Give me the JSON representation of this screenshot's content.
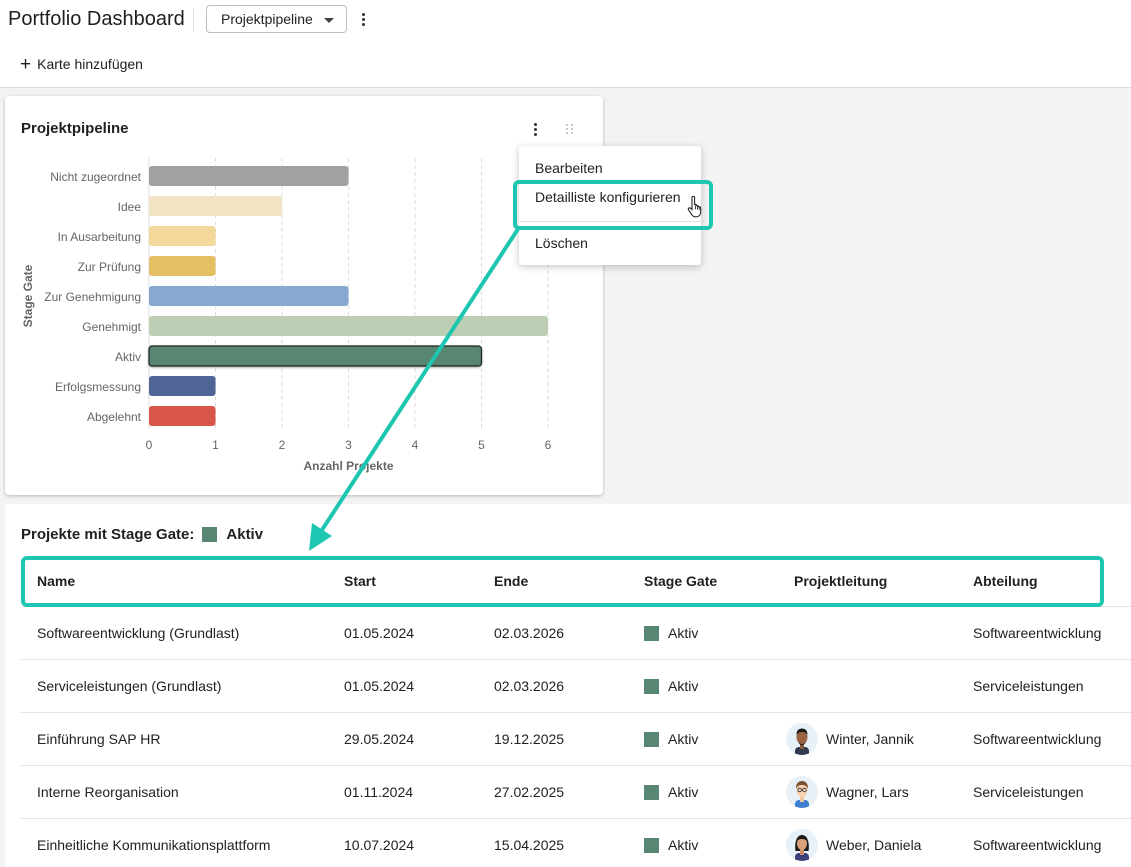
{
  "header": {
    "title": "Portfolio Dashboard",
    "view_select": "Projektpipeline",
    "add_card_label": "Karte hinzufügen"
  },
  "chart_card": {
    "title": "Projektpipeline"
  },
  "chart_data": {
    "type": "bar",
    "orientation": "horizontal",
    "categories": [
      "Nicht zugeordnet",
      "Idee",
      "In Ausarbeitung",
      "Zur Prüfung",
      "Zur Genehmigung",
      "Genehmigt",
      "Aktiv",
      "Erfolgsmessung",
      "Abgelehnt"
    ],
    "values": [
      3,
      2,
      1,
      1,
      3,
      6,
      5,
      1,
      1
    ],
    "colors": [
      "#a1a1a1",
      "#f0e4c5",
      "#f4d79b",
      "#e4c064",
      "#87a8d0",
      "#bccfb4",
      "#578672",
      "#4f6595",
      "#d9564a"
    ],
    "highlighted_category": "Aktiv",
    "xlabel": "Anzahl Projekte",
    "ylabel": "Stage Gate",
    "xlim": [
      0,
      6
    ],
    "xticks": [
      0,
      1,
      2,
      3,
      4,
      5,
      6
    ],
    "grid": "vertical dashed"
  },
  "context_menu": {
    "items": [
      "Bearbeiten",
      "Detailliste konfigurieren",
      "Löschen"
    ]
  },
  "detail_list": {
    "title": "Projekte mit Stage Gate:",
    "stage": "Aktiv",
    "stage_color": "#578672",
    "columns": [
      "Name",
      "Start",
      "Ende",
      "Stage Gate",
      "Projektleitung",
      "Abteilung"
    ],
    "rows": [
      {
        "name": "Softwareentwicklung (Grundlast)",
        "start": "01.05.2024",
        "end": "02.03.2026",
        "stage": "Aktiv",
        "lead": "",
        "dept": "Softwareentwicklung"
      },
      {
        "name": "Serviceleistungen (Grundlast)",
        "start": "01.05.2024",
        "end": "02.03.2026",
        "stage": "Aktiv",
        "lead": "",
        "dept": "Serviceleistungen"
      },
      {
        "name": "Einführung SAP HR",
        "start": "29.05.2024",
        "end": "19.12.2025",
        "stage": "Aktiv",
        "lead": "Winter, Jannik",
        "dept": "Softwareentwicklung"
      },
      {
        "name": "Interne Reorganisation",
        "start": "01.11.2024",
        "end": "27.02.2025",
        "stage": "Aktiv",
        "lead": "Wagner, Lars",
        "dept": "Serviceleistungen"
      },
      {
        "name": "Einheitliche Kommunikationsplattform",
        "start": "10.07.2024",
        "end": "15.04.2025",
        "stage": "Aktiv",
        "lead": "Weber, Daniela",
        "dept": "Softwareentwicklung"
      }
    ]
  },
  "annotation": {
    "highlight_color": "#1ec6b1"
  }
}
